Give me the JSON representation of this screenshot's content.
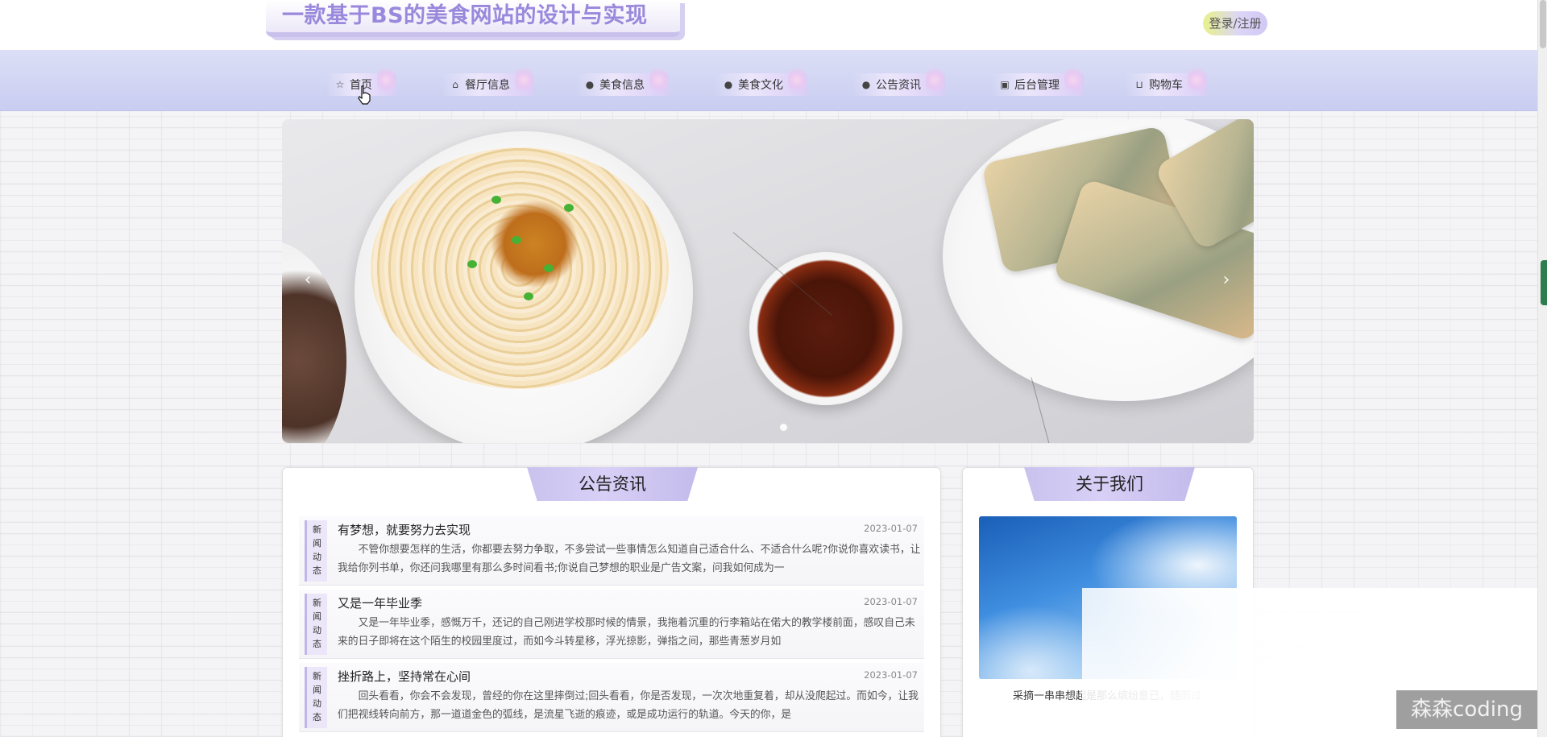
{
  "header": {
    "site_title": "一款基于BS的美食网站的设计与实现",
    "login_label": "登录/注册"
  },
  "nav": {
    "items": [
      {
        "label": "首页",
        "icon": "star-icon"
      },
      {
        "label": "餐厅信息",
        "icon": "bag-icon"
      },
      {
        "label": "美食信息",
        "icon": "info-circle-icon"
      },
      {
        "label": "美食文化",
        "icon": "question-circle-icon"
      },
      {
        "label": "公告资讯",
        "icon": "info-circle-icon"
      },
      {
        "label": "后台管理",
        "icon": "building-icon"
      },
      {
        "label": "购物车",
        "icon": "cart-icon"
      }
    ]
  },
  "banner": {
    "prev_symbol": "‹",
    "next_symbol": "›"
  },
  "news": {
    "title": "公告资讯",
    "items": [
      {
        "tag": "新闻动态",
        "title": "有梦想，就要努力去实现",
        "date": "2023-01-07",
        "body": "不管你想要怎样的生活，你都要去努力争取，不多尝试一些事情怎么知道自己适合什么、不适合什么呢?你说你喜欢读书，让我给你列书单，你还问我哪里有那么多时间看书;你说自己梦想的职业是广告文案，问我如何成为一"
      },
      {
        "tag": "新闻动态",
        "title": "又是一年毕业季",
        "date": "2023-01-07",
        "body": "又是一年毕业季，感慨万千，还记的自己刚进学校那时候的情景，我拖着沉重的行李箱站在偌大的教学楼前面，感叹自己未来的日子即将在这个陌生的校园里度过，而如今斗转星移，浮光掠影，弹指之间，那些青葱岁月如"
      },
      {
        "tag": "新闻动态",
        "title": "挫折路上，坚持常在心间",
        "date": "2023-01-07",
        "body": "回头看看，你会不会发现，曾经的你在这里摔倒过;回头看看，你是否发现，一次次地重复着，却从没爬起过。而如今，让我们把视线转向前方，那一道道金色的弧线，是流星飞逝的痕迹，或是成功运行的轨道。今天的你，是"
      }
    ]
  },
  "about": {
    "title": "关于我们",
    "text": "采摘一串串想起是那么缤纷意已，随而过"
  },
  "overlay": {
    "watermark": "森森coding"
  },
  "colors": {
    "accent": "#9a88dc",
    "nav_bg": "#c9cdf0",
    "panel_header": "#c8c2ee"
  }
}
